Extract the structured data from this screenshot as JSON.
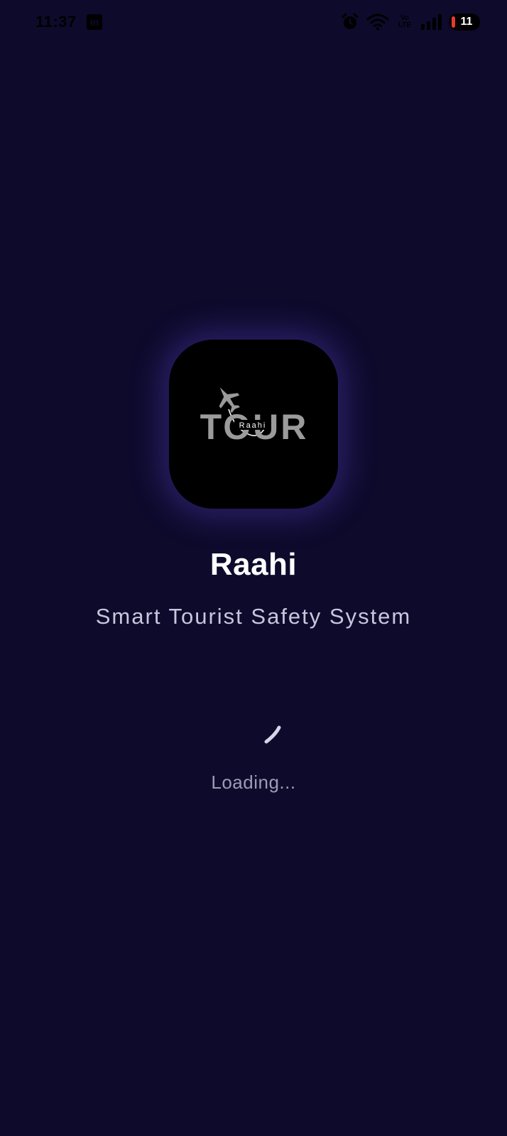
{
  "status_bar": {
    "time": "11:37",
    "notification_icon": "linkedin-icon",
    "icons": [
      "alarm-icon",
      "wifi-icon",
      "volte-icon",
      "signal-icon",
      "battery-icon"
    ],
    "volte_label_top": "Vo",
    "volte_label_bottom": "LTE",
    "battery_level": "11",
    "battery_color": "#e53935"
  },
  "splash": {
    "logo": {
      "wordmark": "TOUR",
      "tagline": "Raahi",
      "icon": "airplane-icon"
    },
    "title": "Raahi",
    "subtitle": "Smart Tourist Safety System",
    "loading_text": "Loading..."
  },
  "colors": {
    "background": "#0e0a2c",
    "title": "#ffffff",
    "subtitle": "#c9c5dc",
    "loading": "#9e9ab4",
    "glow": "#5846c8"
  }
}
